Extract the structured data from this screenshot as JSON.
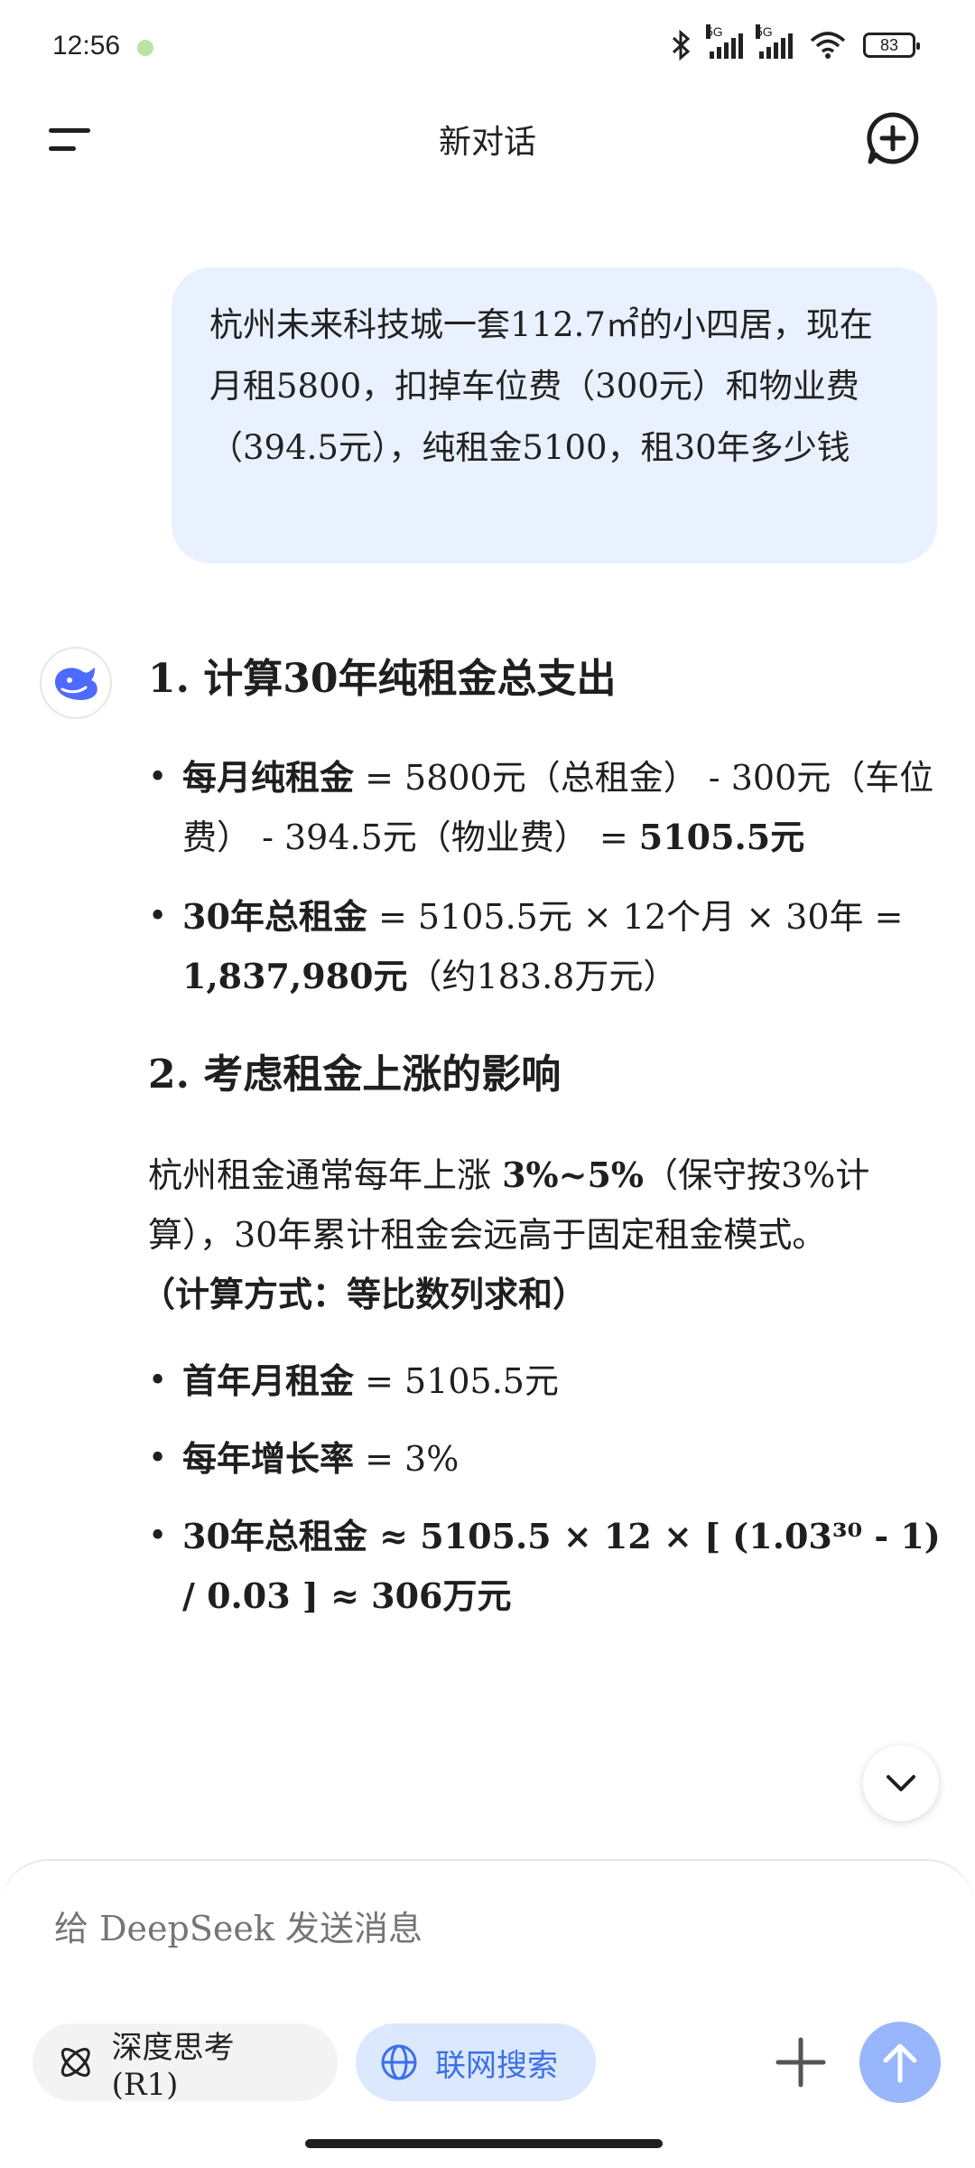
{
  "status_bar": {
    "time": "12:56",
    "network_1": "5G",
    "network_2": "5G",
    "wifi_sub": "6",
    "battery": "83"
  },
  "header": {
    "title": "新对话"
  },
  "user_message": "杭州未来科技城一套112.7㎡的小四居，现在月租5800，扣掉车位费（300元）和物业费（394.5元），纯租金5100，租30年多少钱",
  "answer": {
    "section1": {
      "heading": "1. 计算30年纯租金总支出",
      "b1": {
        "label": "每月纯租金",
        "text": " = 5800元（总租金） - 300元（车位费） - 394.5元（物业费） = ",
        "result": "5105.5元"
      },
      "b2": {
        "label": "30年总租金",
        "text": " = 5105.5元 × 12个月 × 30年 = ",
        "result": "1,837,980元",
        "suffix": "（约183.8万元）"
      }
    },
    "section2": {
      "heading": "2. 考虑租金上涨的影响",
      "para_start": "杭州租金通常每年上涨 ",
      "para_bold": "3%~5%",
      "para_end": "（保守按3%计算），30年累计租金会远高于固定租金模式。",
      "method": "（计算方式：等比数列求和）",
      "b1": {
        "label": "首年月租金",
        "text": " = 5105.5元"
      },
      "b2": {
        "label": "每年增长率",
        "text": " = 3%"
      },
      "b3": {
        "label": "30年总租金",
        "text": " ≈ 5105.5 × 12 × [ (1.03³⁰ - 1) / 0.03 ] ≈ 306万元"
      }
    }
  },
  "composer": {
    "placeholder": "给 DeepSeek 发送消息",
    "deep_think_label": "深度思考 (R1)",
    "web_search_label": "联网搜索"
  },
  "colors": {
    "accent": "#4d6bfe",
    "bubble": "#e9f0fe",
    "send": "#97b6fb"
  }
}
